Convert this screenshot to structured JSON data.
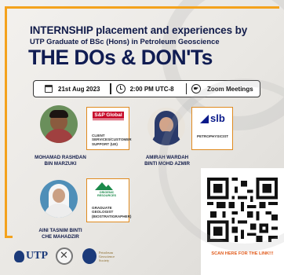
{
  "header": {
    "headline": "INTERNSHIP placement and experiences by",
    "subline": "UTP Graduate of BSc (Hons) in Petroleum Geoscience",
    "title": "THE DOs & DON'Ts"
  },
  "info_bar": {
    "date": "21st Aug 2023",
    "time": "2:00 PM UTC-8",
    "platform": "Zoom Meetings",
    "icons": [
      "calendar-icon",
      "clock-icon",
      "video-camera-icon"
    ]
  },
  "speakers": [
    {
      "name_line1": "MOHAMAD RASHDAN",
      "name_line2": "BIN MARZUKI",
      "company": "S&P Global",
      "role_lines": [
        "CLIENT",
        "SERVICES/CUSTOMER",
        "SUPPORT (UE)"
      ]
    },
    {
      "name_line1": "AMIRAH WARDAH",
      "name_line2": "BINTI MOHD AZMIR",
      "company": "slb",
      "role_lines": [
        "PETROPHYSICIST"
      ]
    },
    {
      "name_line1": "AINI TASNIM BINTI",
      "name_line2": "CHE MAHADZIR",
      "company_lines": [
        "ORIGENIC",
        "RESOURCES"
      ],
      "role_lines": [
        "GRADUATE",
        "GEOLOGIST",
        "(BIOSTRATIGRAPHER)"
      ]
    }
  ],
  "qr": {
    "caption": "SCAN HERE FOR THE LINK!!!"
  },
  "footer": {
    "utp_text": "UTP",
    "society_lines": [
      "Petroleum",
      "Geoscience",
      "Society"
    ]
  },
  "colors": {
    "navy": "#121c4a",
    "accent_orange": "#f4a21c",
    "caption_orange": "#e05a1a",
    "sp_red": "#c8102e",
    "slb_blue": "#0a1a8a",
    "origenic_green": "#1b8a4b"
  }
}
